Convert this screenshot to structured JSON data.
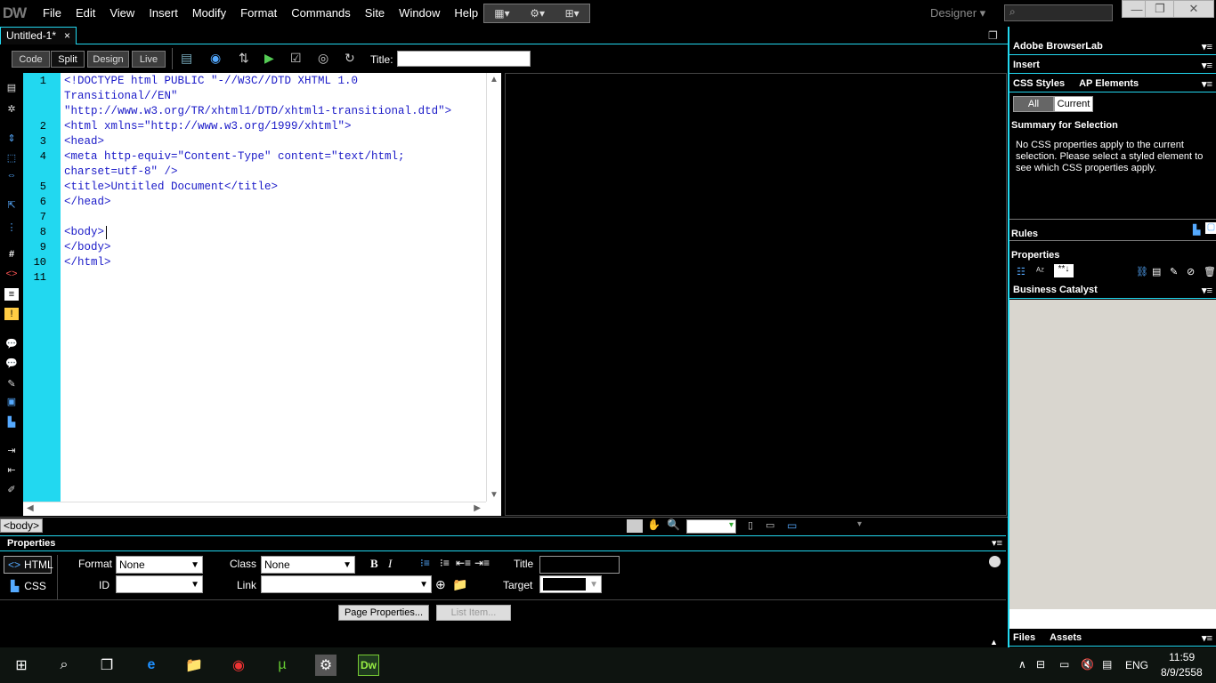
{
  "app": {
    "logo": "DW"
  },
  "menu": [
    "File",
    "Edit",
    "View",
    "Insert",
    "Modify",
    "Format",
    "Commands",
    "Site",
    "Window",
    "Help"
  ],
  "workspace": {
    "label": "Designer"
  },
  "doc_tab": {
    "name": "Untitled-1*",
    "close": "×"
  },
  "view_buttons": {
    "code": "Code",
    "split": "Split",
    "design": "Design",
    "live": "Live"
  },
  "title_field": {
    "label": "Title:",
    "value": ""
  },
  "code_lines": [
    {
      "num": "1",
      "text": "<!DOCTYPE html PUBLIC \"-//W3C//DTD XHTML 1.0"
    },
    {
      "num": "",
      "text": "Transitional//EN\""
    },
    {
      "num": "",
      "text": "\"http://www.w3.org/TR/xhtml1/DTD/xhtml1-transitional.dtd\">"
    },
    {
      "num": "2",
      "text": "<html xmlns=\"http://www.w3.org/1999/xhtml\">"
    },
    {
      "num": "3",
      "text": "<head>"
    },
    {
      "num": "4",
      "text": "<meta http-equiv=\"Content-Type\" content=\"text/html;"
    },
    {
      "num": "",
      "text": "charset=utf-8\" />"
    },
    {
      "num": "5",
      "text": "<title>Untitled Document</title>"
    },
    {
      "num": "6",
      "text": "</head>"
    },
    {
      "num": "7",
      "text": ""
    },
    {
      "num": "8",
      "text": "<body>"
    },
    {
      "num": "9",
      "text": "</body>"
    },
    {
      "num": "10",
      "text": "</html>"
    },
    {
      "num": "11",
      "text": ""
    }
  ],
  "status": {
    "tag": "<body>"
  },
  "properties": {
    "header": "Properties",
    "html_btn": "HTML",
    "css_btn": "CSS",
    "format_label": "Format",
    "format_value": "None",
    "class_label": "Class",
    "class_value": "None",
    "id_label": "ID",
    "id_value": "",
    "link_label": "Link",
    "link_value": "",
    "title_label": "Title",
    "title_value": "",
    "target_label": "Target",
    "target_value": "",
    "page_properties": "Page Properties...",
    "list_item": "List Item..."
  },
  "right_panel": {
    "browserlab": "Adobe BrowserLab",
    "insert": "Insert",
    "css_styles": "CSS Styles",
    "ap_elements": "AP Elements",
    "all": "All",
    "current": "Current",
    "summary_title": "Summary for Selection",
    "summary_text": "No CSS properties apply to the current selection.  Please select a styled element to see which CSS properties apply.",
    "rules": "Rules",
    "properties": "Properties",
    "business_catalyst": "Business Catalyst",
    "files": "Files",
    "assets": "Assets"
  },
  "taskbar": {
    "lang": "ENG",
    "time": "11:59",
    "date": "8/9/2558"
  },
  "colors": {
    "accent": "#22d8f0",
    "gutter": "#22d8f0",
    "code_text": "#1a1ac8"
  }
}
